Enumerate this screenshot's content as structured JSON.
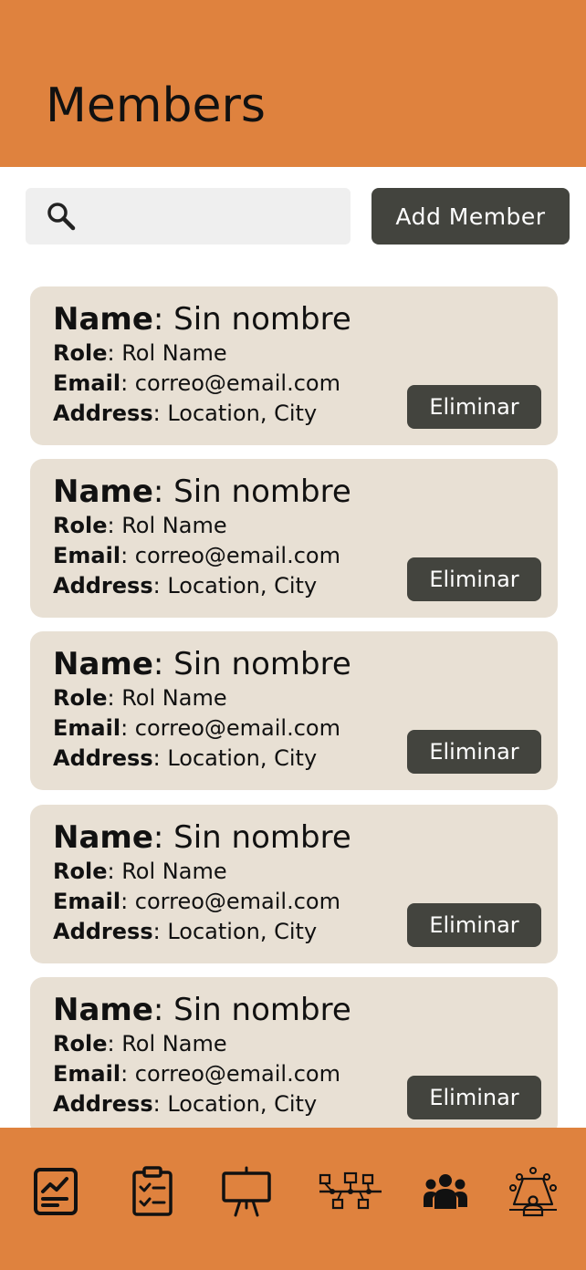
{
  "header": {
    "title": "Members"
  },
  "search": {
    "placeholder": "",
    "value": ""
  },
  "toolbar": {
    "add_label": "Add Member"
  },
  "labels": {
    "name": "Name",
    "role": "Role",
    "email": "Email",
    "address": "Address"
  },
  "members": [
    {
      "name": "Sin nombre",
      "role": "Rol Name",
      "email": "correo@email.com",
      "address": "Location, City",
      "delete_label": "Eliminar"
    },
    {
      "name": "Sin nombre",
      "role": "Rol Name",
      "email": "correo@email.com",
      "address": "Location, City",
      "delete_label": "Eliminar"
    },
    {
      "name": "Sin nombre",
      "role": "Rol Name",
      "email": "correo@email.com",
      "address": "Location, City",
      "delete_label": "Eliminar"
    },
    {
      "name": "Sin nombre",
      "role": "Rol Name",
      "email": "correo@email.com",
      "address": "Location, City",
      "delete_label": "Eliminar"
    },
    {
      "name": "Sin nombre",
      "role": "Rol Name",
      "email": "correo@email.com",
      "address": "Location, City",
      "delete_label": "Eliminar"
    }
  ],
  "nav": {
    "items": [
      {
        "icon": "report-chart-icon",
        "active": false
      },
      {
        "icon": "clipboard-checklist-icon",
        "active": false
      },
      {
        "icon": "presentation-board-icon",
        "active": false
      },
      {
        "icon": "workflow-diagram-icon",
        "active": false
      },
      {
        "icon": "members-group-icon",
        "active": true
      },
      {
        "icon": "meeting-table-icon",
        "active": false
      }
    ]
  },
  "colors": {
    "accent": "#DF823E",
    "card": "#E8E0D4",
    "button": "#43443E",
    "search_bg": "#EFEFEF"
  }
}
